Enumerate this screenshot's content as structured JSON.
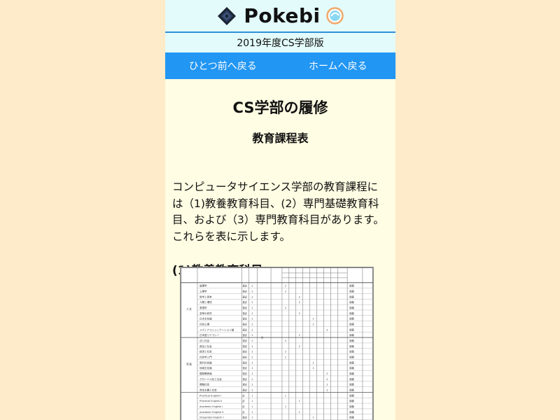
{
  "header": {
    "brand": "Pokebi",
    "edition": "2019年度CS学部版"
  },
  "nav": {
    "back_label": "ひとつ前へ戻る",
    "home_label": "ホームへ戻る"
  },
  "main": {
    "title": "CS学部の履修",
    "subtitle": "教育課程表",
    "intro": "コンピュータサイエンス学部の教育課程には（1)教養教育科目、(2）専門基礎教育科目、および（3）専門教育科目があります。これらを表に示します。",
    "section_heading": "(1)教養教育科目"
  },
  "table_image": {
    "groups": [
      "人文",
      "社会"
    ],
    "group_total": "8",
    "courses": [
      {
        "name": "倫理学",
        "cat": "選必",
        "cr": "2",
        "yr": "1"
      },
      {
        "name": "心理学",
        "cat": "選必",
        "cr": "2",
        "yr": "1"
      },
      {
        "name": "哲学と思考",
        "cat": "選必",
        "cr": "2",
        "yr": "2"
      },
      {
        "name": "人間と環境",
        "cat": "選必",
        "cr": "2",
        "yr": "2"
      },
      {
        "name": "表現学",
        "cat": "選必",
        "cr": "2",
        "yr": "1"
      },
      {
        "name": "多摩の研究",
        "cat": "選必",
        "cr": "2",
        "yr": "2"
      },
      {
        "name": "日本文化論",
        "cat": "選必",
        "cr": "2",
        "yr": "3"
      },
      {
        "name": "社会心理",
        "cat": "選必",
        "cr": "2",
        "yr": "3"
      },
      {
        "name": "メディアコミュニケーション論",
        "cat": "選必",
        "cr": "2",
        "yr": "4"
      },
      {
        "name": "日本語リテラシー",
        "cat": "選必",
        "cr": "2",
        "yr": "2"
      },
      {
        "name": "法と社会",
        "cat": "選必",
        "cr": "2",
        "yr": "1"
      },
      {
        "name": "政治と社会",
        "cat": "選必",
        "cr": "2",
        "yr": "2"
      },
      {
        "name": "経済と社会",
        "cat": "選必",
        "cr": "2",
        "yr": "1"
      },
      {
        "name": "社会学入門",
        "cat": "選必",
        "cr": "2",
        "yr": "1"
      },
      {
        "name": "現代社会論",
        "cat": "選必",
        "cr": "2",
        "yr": "3"
      },
      {
        "name": "地域文化論",
        "cat": "選必",
        "cr": "2",
        "yr": "3"
      },
      {
        "name": "国際関係論",
        "cat": "選必",
        "cr": "2",
        "yr": "4"
      },
      {
        "name": "グローバル化と社会",
        "cat": "選必",
        "cr": "2",
        "yr": "4"
      },
      {
        "name": "情報社会",
        "cat": "選必",
        "cr": "2",
        "yr": "4"
      },
      {
        "name": "資本主義と社会",
        "cat": "選必",
        "cr": "2",
        "yr": "4"
      },
      {
        "name": "Practical English I",
        "cat": "必",
        "cr": "1",
        "yr": "1"
      },
      {
        "name": "Practical English II",
        "cat": "必",
        "cr": "1",
        "yr": "2"
      },
      {
        "name": "Academic English I",
        "cat": "必",
        "cr": "1",
        "yr": "1"
      },
      {
        "name": "Academic English II",
        "cat": "必",
        "cr": "1",
        "yr": "2"
      },
      {
        "name": "Integrated English I",
        "cat": "選必",
        "cr": "1",
        "yr": "3"
      }
    ]
  }
}
